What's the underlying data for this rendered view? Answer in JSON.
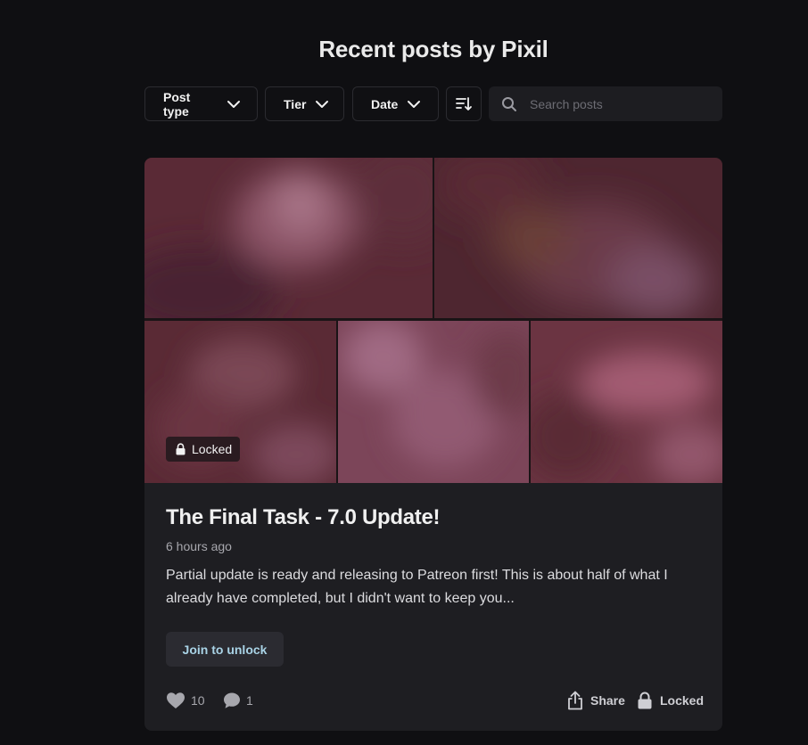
{
  "page": {
    "heading": "Recent posts by Pixil"
  },
  "filters": {
    "post_type": "Post type",
    "tier": "Tier",
    "date": "Date",
    "search_placeholder": "Search posts"
  },
  "post": {
    "badge": "Locked",
    "title": "The Final Task - 7.0 Update!",
    "time": "6 hours ago",
    "excerpt": "Partial update is ready and releasing to Patreon first! This is about half of what I already have completed, but I didn't want to keep you...",
    "join_label": "Join to unlock",
    "likes": "10",
    "comments": "1",
    "share_label": "Share",
    "locked_label": "Locked",
    "images_count": 5
  },
  "icons": {
    "chevron": "chevron-down-icon",
    "sort": "sort-icon",
    "search": "search-icon",
    "lock": "lock-icon",
    "heart": "heart-icon",
    "comment": "comment-icon",
    "share": "share-icon"
  },
  "colors": {
    "background": "#0f0f12",
    "card": "#1e1e22",
    "join_text": "#a9d3e6",
    "badge_bg": "#2a1b20"
  }
}
